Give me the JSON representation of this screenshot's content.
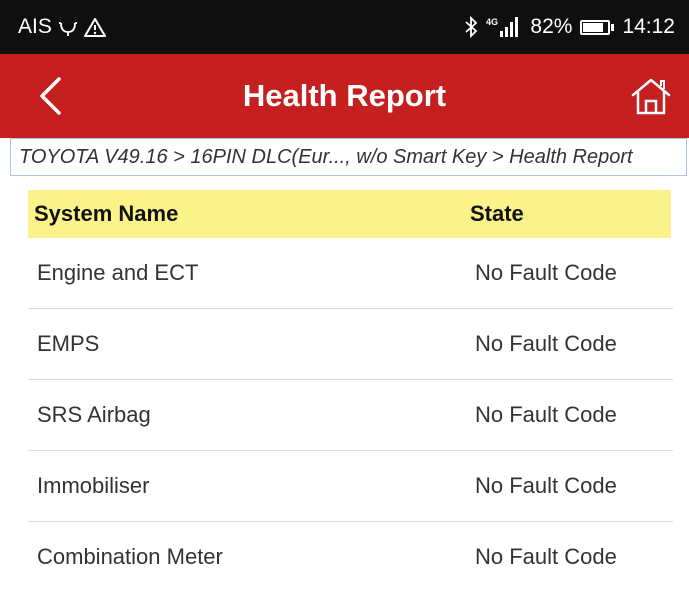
{
  "status_bar": {
    "carrier": "AIS",
    "network": "4G",
    "battery_percent": "82%",
    "battery_level": 0.82,
    "time": "14:12"
  },
  "app_bar": {
    "title": "Health Report",
    "back_icon": "chevron-left-icon",
    "home_icon": "home-icon",
    "background": "#c51f1f"
  },
  "breadcrumb": {
    "text": "TOYOTA V49.16 > 16PIN DLC(Eur..., w/o Smart Key > Health Report"
  },
  "table": {
    "header_bg": "#fbf28a",
    "columns": [
      "System Name",
      "State"
    ],
    "rows": [
      {
        "name": "Engine and ECT",
        "state": "No Fault Code"
      },
      {
        "name": "EMPS",
        "state": "No Fault Code"
      },
      {
        "name": "SRS Airbag",
        "state": "No Fault Code"
      },
      {
        "name": "Immobiliser",
        "state": "No Fault Code"
      },
      {
        "name": "Combination Meter",
        "state": "No Fault Code"
      }
    ]
  }
}
